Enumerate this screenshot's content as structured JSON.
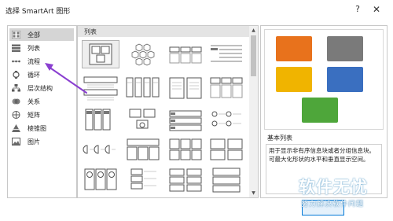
{
  "window": {
    "title": "选择 SmartArt 图形",
    "help_label": "?",
    "close_label": "✕"
  },
  "categories": [
    {
      "label": "全部",
      "icon": "all-grid-icon"
    },
    {
      "label": "列表",
      "icon": "list-icon"
    },
    {
      "label": "流程",
      "icon": "process-icon"
    },
    {
      "label": "循环",
      "icon": "cycle-icon"
    },
    {
      "label": "层次结构",
      "icon": "hierarchy-icon"
    },
    {
      "label": "关系",
      "icon": "relationship-icon"
    },
    {
      "label": "矩阵",
      "icon": "matrix-icon"
    },
    {
      "label": "棱锥图",
      "icon": "pyramid-icon"
    },
    {
      "label": "图片",
      "icon": "picture-icon"
    }
  ],
  "selected_category": "全部",
  "gallery": {
    "header": "列表"
  },
  "preview": {
    "name": "基本列表",
    "description": "用于显示非有序信息块或者分组信息块。可最大化形状的水平和垂直显示空间。",
    "colors": [
      "#e8721c",
      "#7a7a7a",
      "#f0b400",
      "#3a6fc0",
      "#4ea63a"
    ]
  },
  "watermark": {
    "main": "软件无忧",
    "sub": "努力解决软件问题"
  },
  "accent_arrow_color": "#8a3fd0"
}
